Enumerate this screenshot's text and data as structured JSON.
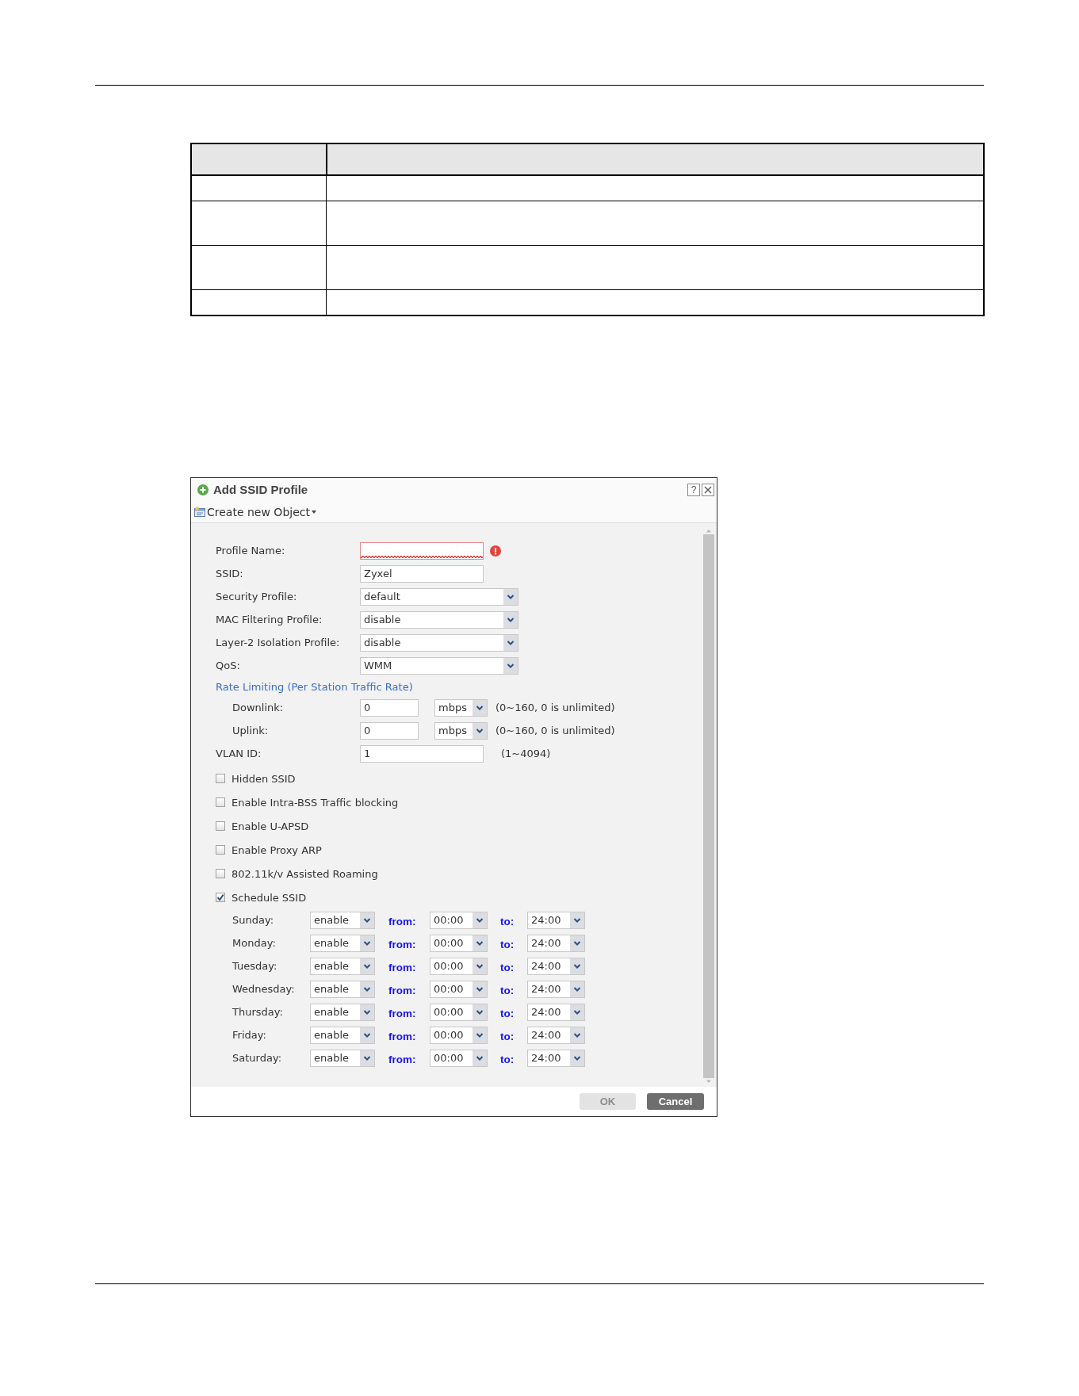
{
  "dialog": {
    "title": "Add SSID Profile",
    "help_button": "?",
    "toolbar": {
      "label": "Create new Object"
    },
    "form": [
      {
        "kind": "text",
        "label": "Profile Name:",
        "invalid": true
      },
      {
        "kind": "text",
        "label": "SSID:",
        "value": "Zyxel",
        "invalid": false
      },
      {
        "kind": "select",
        "label": "Security Profile:",
        "value": "default"
      },
      {
        "kind": "select",
        "label": "MAC Filtering Profile:",
        "value": "disable"
      },
      {
        "kind": "select",
        "label": "Layer-2 Isolation Profile:",
        "value": "disable"
      },
      {
        "kind": "select",
        "label": "QoS:",
        "value": "WMM"
      },
      {
        "kind": "heading",
        "label": "Rate Limiting (Per Station Traffic Rate)"
      },
      {
        "kind": "rate",
        "label": "Downlink:",
        "value": "0",
        "unit": "mbps",
        "hint": "(0~160, 0 is unlimited)"
      },
      {
        "kind": "rate",
        "label": "Uplink:",
        "value": "0",
        "unit": "mbps",
        "hint": "(0~160, 0 is unlimited)"
      },
      {
        "kind": "text",
        "label": "VLAN ID:",
        "value": "1",
        "hint": "(1~4094)",
        "invalid": false
      }
    ],
    "options": [
      {
        "label": "Hidden SSID",
        "checked": false
      },
      {
        "label": "Enable Intra-BSS Traffic blocking",
        "checked": false
      },
      {
        "label": "Enable U-APSD",
        "checked": false
      },
      {
        "label": "Enable Proxy ARP",
        "checked": false
      },
      {
        "label": "802.11k/v Assisted Roaming",
        "checked": false
      },
      {
        "label": "Schedule SSID",
        "checked": true
      }
    ],
    "schedule": [
      {
        "day": "Sunday:",
        "state": "enable",
        "from_label": "from:",
        "from": "00:00",
        "to_label": "to:",
        "to": "24:00"
      },
      {
        "day": "Monday:",
        "state": "enable",
        "from_label": "from:",
        "from": "00:00",
        "to_label": "to:",
        "to": "24:00"
      },
      {
        "day": "Tuesday:",
        "state": "enable",
        "from_label": "from:",
        "from": "00:00",
        "to_label": "to:",
        "to": "24:00"
      },
      {
        "day": "Wednesday:",
        "state": "enable",
        "from_label": "from:",
        "from": "00:00",
        "to_label": "to:",
        "to": "24:00"
      },
      {
        "day": "Thursday:",
        "state": "enable",
        "from_label": "from:",
        "from": "00:00",
        "to_label": "to:",
        "to": "24:00"
      },
      {
        "day": "Friday:",
        "state": "enable",
        "from_label": "from:",
        "from": "00:00",
        "to_label": "to:",
        "to": "24:00"
      },
      {
        "day": "Saturday:",
        "state": "enable",
        "from_label": "from:",
        "from": "00:00",
        "to_label": "to:",
        "to": "24:00"
      }
    ],
    "buttons": [
      {
        "label": "OK",
        "disabled": true
      },
      {
        "label": "Cancel",
        "disabled": false
      }
    ]
  }
}
